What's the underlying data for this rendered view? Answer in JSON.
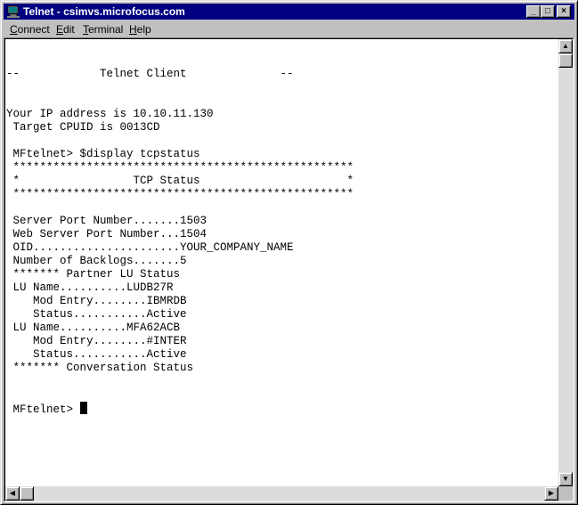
{
  "window": {
    "title": "Telnet - csimvs.microfocus.com"
  },
  "menu": {
    "connect": {
      "accel": "C",
      "rest": "onnect"
    },
    "edit": {
      "accel": "E",
      "rest": "dit"
    },
    "terminal": {
      "accel": "T",
      "rest": "erminal"
    },
    "help": {
      "accel": "H",
      "rest": "elp"
    }
  },
  "titlebar_buttons": {
    "minimize": "_",
    "maximize": "□",
    "close": "×"
  },
  "scroll_glyphs": {
    "up": "▲",
    "down": "▼",
    "left": "◀",
    "right": "▶"
  },
  "terminal": {
    "lines": [
      "",
      "",
      "--            Telnet Client              --",
      "",
      "",
      "Your IP address is 10.10.11.130",
      " Target CPUID is 0013CD",
      "",
      " MFtelnet> $display tcpstatus",
      " ***************************************************",
      " *                 TCP Status                      *",
      " ***************************************************",
      "",
      " Server Port Number.......1503",
      " Web Server Port Number...1504",
      " OID......................YOUR_COMPANY_NAME",
      " Number of Backlogs.......5",
      " ******* Partner LU Status",
      " LU Name..........LUDB27R",
      "    Mod Entry........IBMRDB",
      "    Status...........Active",
      " LU Name..........MFA62ACB",
      "    Mod Entry........#INTER",
      "    Status...........Active",
      " ******* Conversation Status",
      "",
      ""
    ],
    "prompt": " MFtelnet> "
  },
  "colors": {
    "titlebar": "#000080",
    "chrome": "#c0c0c0",
    "terminal_bg": "#ffffff",
    "terminal_fg": "#000000"
  }
}
